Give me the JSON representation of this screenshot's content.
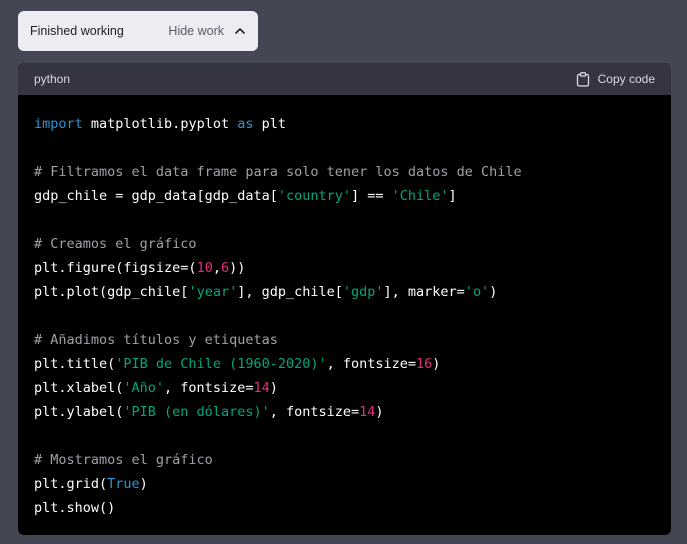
{
  "status": {
    "label": "Finished working",
    "hide_label": "Hide work"
  },
  "code": {
    "language": "python",
    "copy_label": "Copy code",
    "lines": [
      [
        {
          "t": "kw",
          "v": "import"
        },
        {
          "t": "plain",
          "v": " matplotlib.pyplot "
        },
        {
          "t": "kw",
          "v": "as"
        },
        {
          "t": "plain",
          "v": " plt"
        }
      ],
      [],
      [
        {
          "t": "com",
          "v": "# Filtramos el data frame para solo tener los datos de Chile"
        }
      ],
      [
        {
          "t": "plain",
          "v": "gdp_chile = gdp_data[gdp_data["
        },
        {
          "t": "str",
          "v": "'country'"
        },
        {
          "t": "plain",
          "v": "] == "
        },
        {
          "t": "str",
          "v": "'Chile'"
        },
        {
          "t": "plain",
          "v": "]"
        }
      ],
      [],
      [
        {
          "t": "com",
          "v": "# Creamos el gráfico"
        }
      ],
      [
        {
          "t": "plain",
          "v": "plt.figure(figsize=("
        },
        {
          "t": "num",
          "v": "10"
        },
        {
          "t": "plain",
          "v": ","
        },
        {
          "t": "num",
          "v": "6"
        },
        {
          "t": "plain",
          "v": "))"
        }
      ],
      [
        {
          "t": "plain",
          "v": "plt.plot(gdp_chile["
        },
        {
          "t": "str",
          "v": "'year'"
        },
        {
          "t": "plain",
          "v": "], gdp_chile["
        },
        {
          "t": "str",
          "v": "'gdp'"
        },
        {
          "t": "plain",
          "v": "], marker="
        },
        {
          "t": "str",
          "v": "'o'"
        },
        {
          "t": "plain",
          "v": ")"
        }
      ],
      [],
      [
        {
          "t": "com",
          "v": "# Añadimos títulos y etiquetas"
        }
      ],
      [
        {
          "t": "plain",
          "v": "plt.title("
        },
        {
          "t": "str",
          "v": "'PIB de Chile (1960-2020)'"
        },
        {
          "t": "plain",
          "v": ", fontsize="
        },
        {
          "t": "num",
          "v": "16"
        },
        {
          "t": "plain",
          "v": ")"
        }
      ],
      [
        {
          "t": "plain",
          "v": "plt.xlabel("
        },
        {
          "t": "str",
          "v": "'Año'"
        },
        {
          "t": "plain",
          "v": ", fontsize="
        },
        {
          "t": "num",
          "v": "14"
        },
        {
          "t": "plain",
          "v": ")"
        }
      ],
      [
        {
          "t": "plain",
          "v": "plt.ylabel("
        },
        {
          "t": "str",
          "v": "'PIB (en dólares)'"
        },
        {
          "t": "plain",
          "v": ", fontsize="
        },
        {
          "t": "num",
          "v": "14"
        },
        {
          "t": "plain",
          "v": ")"
        }
      ],
      [],
      [
        {
          "t": "com",
          "v": "# Mostramos el gráfico"
        }
      ],
      [
        {
          "t": "plain",
          "v": "plt.grid("
        },
        {
          "t": "kw",
          "v": "True"
        },
        {
          "t": "plain",
          "v": ")"
        }
      ],
      [
        {
          "t": "plain",
          "v": "plt.show()"
        }
      ]
    ]
  },
  "icons": {
    "chevron": "chevron-up-icon",
    "copy": "clipboard-icon"
  },
  "colors": {
    "background": "#444654",
    "keyword": "#2e95d3",
    "string": "#00a67d",
    "number": "#df3079",
    "comment": "#a0a0a8"
  }
}
